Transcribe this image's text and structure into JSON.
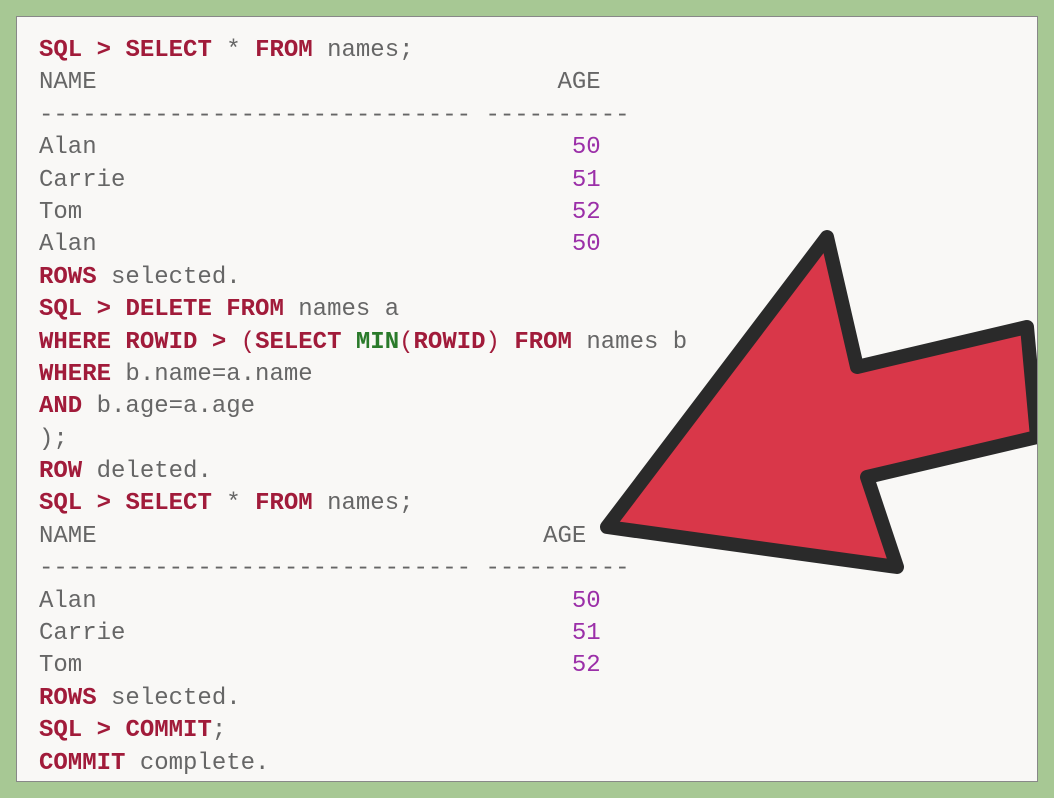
{
  "prompt": "SQL",
  "gt": ">",
  "kwSelect": "SELECT",
  "kwFrom": "FROM",
  "kwDelete": "DELETE FROM",
  "kwWhere": "WHERE",
  "kwRowid": "ROWID",
  "kwMin": "MIN",
  "kwAnd": "AND",
  "kwRow": "ROW",
  "kwRows": "ROWS",
  "kwCommit": "COMMIT",
  "kwCommitB": "COMMIT",
  "star": "*",
  "tableNames": "names",
  "aliasA": "a",
  "aliasB": "b",
  "semi": ";",
  "closeParenSemi": ");",
  "openParen": "(",
  "closeParen": ")",
  "condBName": "b.name=a.name",
  "condBAge": "b.age=a.age",
  "headerName": "NAME",
  "headerAge": "AGE",
  "dashes": "------------------------------ ----------",
  "rows1": {
    "r1name": "Alan",
    "r1age": "50",
    "r2name": "Carrie",
    "r2age": "51",
    "r3name": "Tom",
    "r3age": "52",
    "r4name": "Alan",
    "r4age": "50"
  },
  "rows2": {
    "r1name": "Alan",
    "r1age": "50",
    "r2name": "Carrie",
    "r2age": "51",
    "r3name": "Tom",
    "r3age": "52"
  },
  "txtSelected": " selected.",
  "txtDeleted": " deleted.",
  "txtComplete": " complete.",
  "namesB": "names b"
}
